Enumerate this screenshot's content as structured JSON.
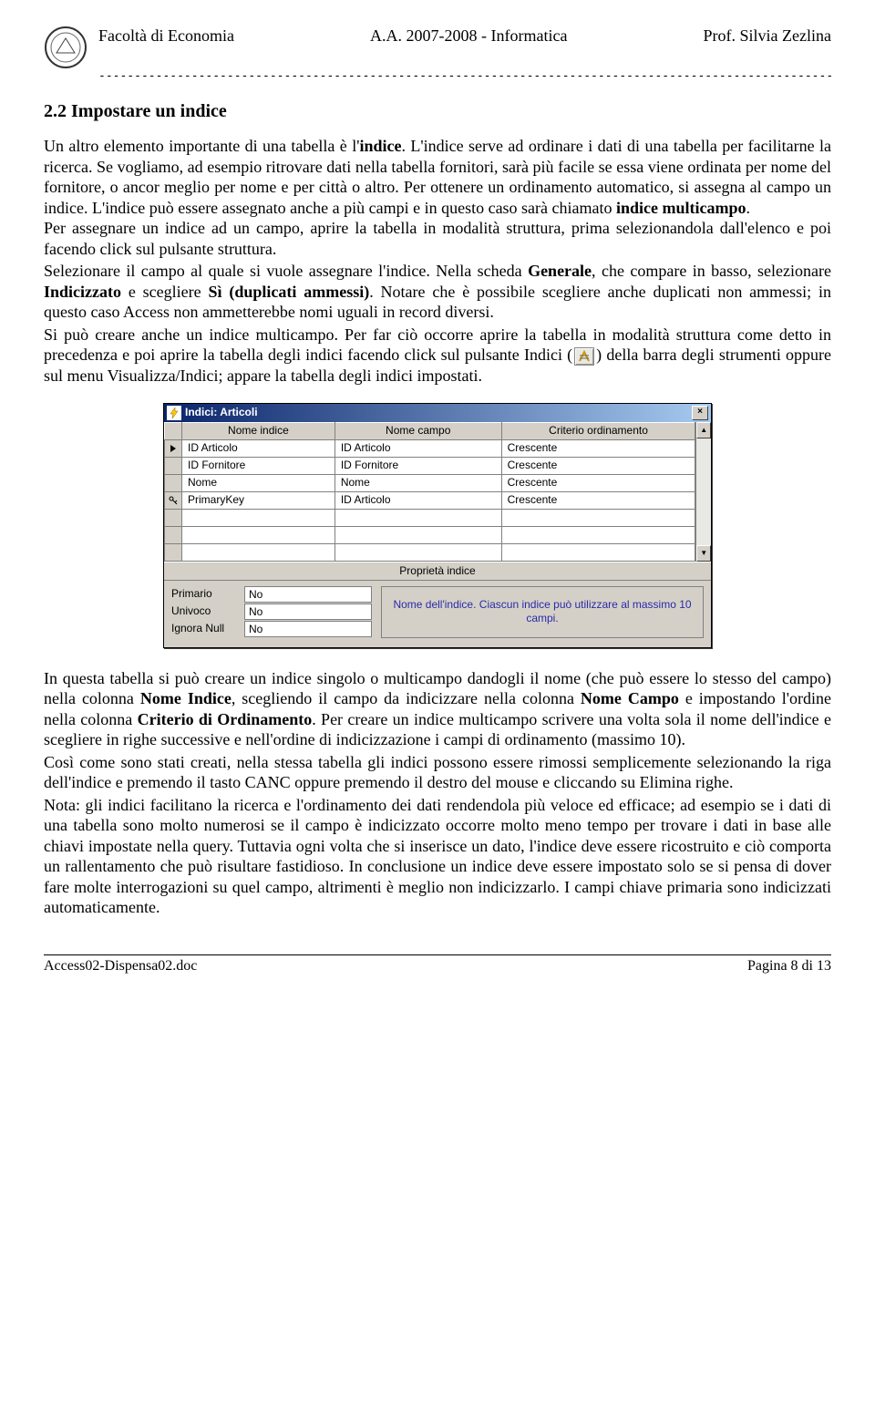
{
  "header": {
    "left": "Facoltà di Economia",
    "center": "A.A. 2007-2008 - Informatica",
    "right": "Prof. Silvia Zezlina"
  },
  "section_title": "2.2 Impostare un indice",
  "para_a": "Un altro elemento importante di una tabella è l'",
  "para_a_bold": "indice",
  "para_a2": ". L'indice serve ad ordinare i dati di una tabella per facilitarne la ricerca. Se vogliamo, ad esempio ritrovare dati nella tabella fornitori, sarà più facile se essa viene ordinata per nome del fornitore, o ancor meglio per nome e per città o altro. Per ottenere un ordinamento automatico, si assegna al campo un indice. L'indice può essere assegnato anche a più campi e in questo caso sarà chiamato ",
  "para_a_bold2": "indice multicampo",
  "para_a3": ".",
  "para_b1": "Per assegnare un indice ad un campo, aprire la tabella in modalità struttura, prima selezionandola dall'elenco e poi facendo click sul pulsante struttura.",
  "para_b2a": "Selezionare il campo al quale si vuole assegnare l'indice. Nella scheda ",
  "para_b2_bold1": "Generale",
  "para_b2b": ", che compare in basso, selezionare ",
  "para_b2_bold2": "Indicizzato",
  "para_b2c": " e scegliere ",
  "para_b2_bold3": "Sì (duplicati ammessi)",
  "para_b2d": ". Notare che è possibile scegliere anche duplicati non ammessi; in questo caso Access non ammetterebbe nomi uguali in record diversi.",
  "para_c1": "Si può creare anche un indice multicampo. Per far ciò occorre aprire la tabella in modalità struttura come detto in precedenza e poi aprire la tabella degli indici facendo click sul pulsante Indici (",
  "para_c2": ") della barra degli strumenti oppure sul menu Visualizza/Indici; appare la tabella degli indici impostati.",
  "window": {
    "title": "Indici: Articoli",
    "cols": {
      "c1": "Nome indice",
      "c2": "Nome campo",
      "c3": "Criterio ordinamento"
    },
    "rows": [
      {
        "icon": "pointer",
        "name": "ID Articolo",
        "field": "ID Articolo",
        "order": "Crescente"
      },
      {
        "icon": "",
        "name": "ID Fornitore",
        "field": "ID Fornitore",
        "order": "Crescente"
      },
      {
        "icon": "",
        "name": "Nome",
        "field": "Nome",
        "order": "Crescente"
      },
      {
        "icon": "key",
        "name": "PrimaryKey",
        "field": "ID Articolo",
        "order": "Crescente"
      },
      {
        "icon": "",
        "name": "",
        "field": "",
        "order": ""
      },
      {
        "icon": "",
        "name": "",
        "field": "",
        "order": ""
      },
      {
        "icon": "",
        "name": "",
        "field": "",
        "order": ""
      }
    ],
    "prop_header": "Proprietà indice",
    "props": [
      {
        "label": "Primario",
        "value": "No"
      },
      {
        "label": "Univoco",
        "value": "No"
      },
      {
        "label": "Ignora Null",
        "value": "No"
      }
    ],
    "help_text": "Nome dell'indice. Ciascun indice può utilizzare al massimo 10 campi."
  },
  "para_d1": "In questa tabella si può creare un indice singolo o multicampo dandogli il nome (che può essere lo stesso del campo) nella colonna ",
  "para_d_bold1": "Nome Indice",
  "para_d2": ", scegliendo il campo da indicizzare nella colonna ",
  "para_d_bold2": "Nome Campo",
  "para_d3": " e impostando l'ordine nella colonna ",
  "para_d_bold3": "Criterio di Ordinamento",
  "para_d4": ". Per creare un indice multicampo scrivere una volta sola il nome dell'indice e scegliere in righe successive e nell'ordine di indicizzazione i campi di ordinamento (massimo 10).",
  "para_e": "Così come sono stati creati, nella stessa tabella gli indici possono essere rimossi semplicemente selezionando la riga dell'indice e premendo il tasto CANC oppure premendo il destro del mouse e cliccando su Elimina righe.",
  "para_f": "Nota: gli indici facilitano la ricerca e l'ordinamento dei dati rendendola più veloce ed efficace; ad esempio se i dati di una tabella sono molto numerosi se il campo è indicizzato occorre molto meno tempo per trovare i dati in base alle chiavi impostate nella query. Tuttavia ogni volta che si inserisce un dato, l'indice deve essere ricostruito e ciò comporta un rallentamento che può risultare fastidioso. In conclusione un indice deve essere impostato solo se si pensa di dover fare molte interrogazioni su quel campo, altrimenti è meglio non indicizzarlo. I campi chiave primaria sono indicizzati automaticamente.",
  "footer": {
    "left": "Access02-Dispensa02.doc",
    "right": "Pagina 8 di 13"
  }
}
